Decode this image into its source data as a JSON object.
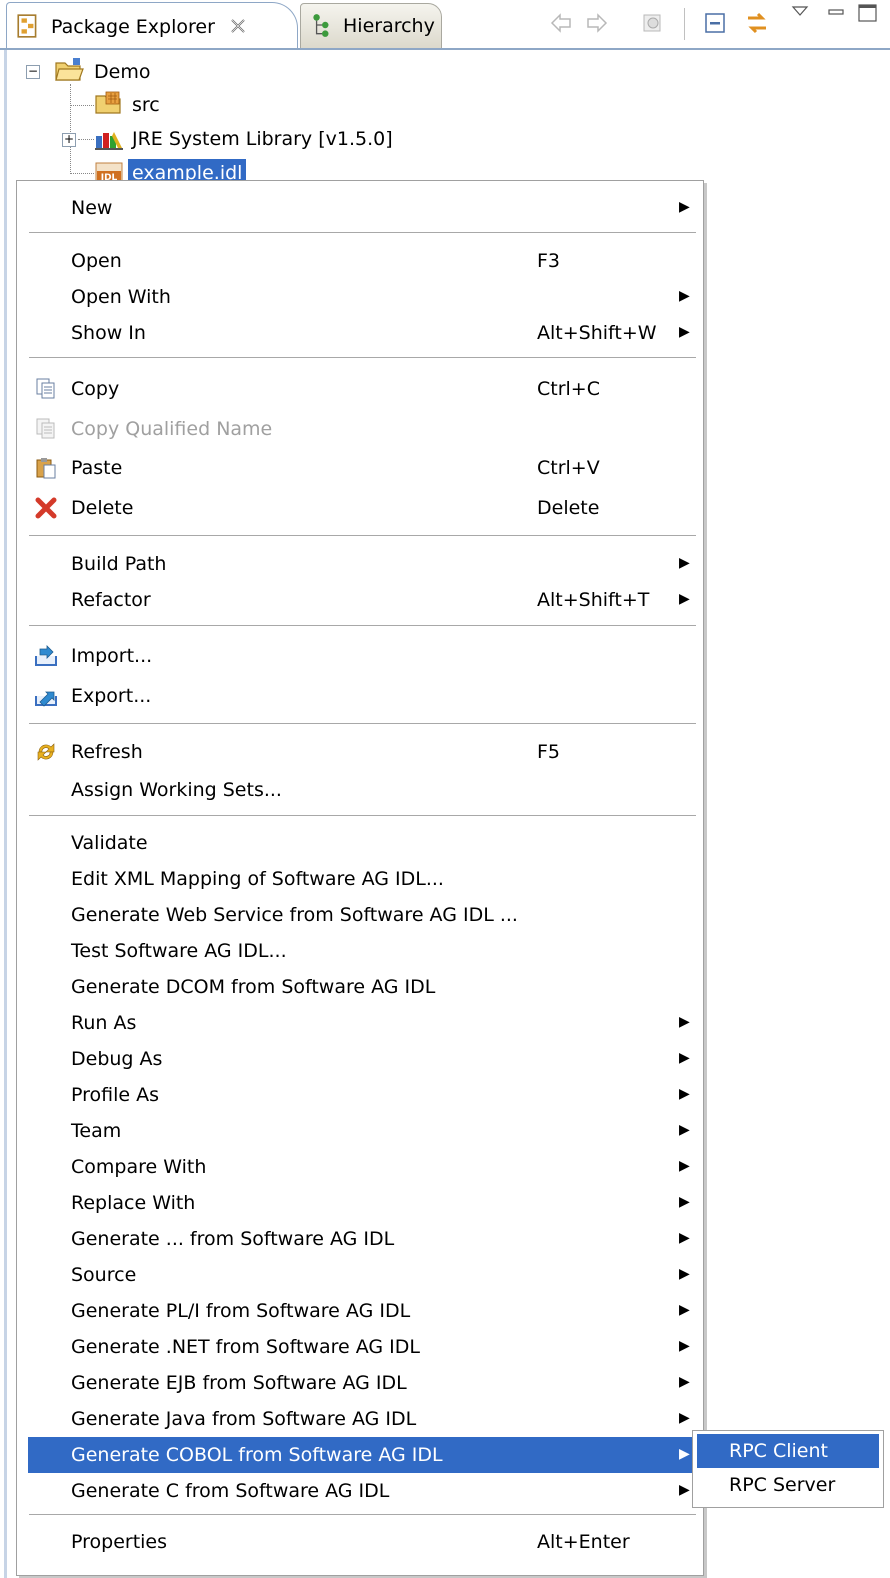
{
  "tabs": {
    "package_explorer": "Package Explorer",
    "hierarchy": "Hierarchy"
  },
  "tree": {
    "project": "Demo",
    "src": "src",
    "jre": "JRE System Library [v1.5.0]",
    "file": "example.idl",
    "file_badge": "IDL"
  },
  "menu": {
    "items": [
      {
        "label": "New",
        "shortcut": "",
        "submenu": true
      },
      {
        "label": "Open",
        "shortcut": "F3",
        "submenu": false
      },
      {
        "label": "Open With",
        "shortcut": "",
        "submenu": true
      },
      {
        "label": "Show In",
        "shortcut": "Alt+Shift+W",
        "submenu": true
      },
      {
        "label": "Copy",
        "shortcut": "Ctrl+C",
        "submenu": false
      },
      {
        "label": "Copy Qualified Name",
        "shortcut": "",
        "submenu": false
      },
      {
        "label": "Paste",
        "shortcut": "Ctrl+V",
        "submenu": false
      },
      {
        "label": "Delete",
        "shortcut": "Delete",
        "submenu": false
      },
      {
        "label": "Build Path",
        "shortcut": "",
        "submenu": true
      },
      {
        "label": "Refactor",
        "shortcut": "Alt+Shift+T",
        "submenu": true
      },
      {
        "label": "Import...",
        "shortcut": "",
        "submenu": false
      },
      {
        "label": "Export...",
        "shortcut": "",
        "submenu": false
      },
      {
        "label": "Refresh",
        "shortcut": "F5",
        "submenu": false
      },
      {
        "label": "Assign Working Sets...",
        "shortcut": "",
        "submenu": false
      },
      {
        "label": "Validate",
        "shortcut": "",
        "submenu": false
      },
      {
        "label": "Edit XML Mapping of Software AG IDL...",
        "shortcut": "",
        "submenu": false
      },
      {
        "label": "Generate Web Service from Software AG IDL ...",
        "shortcut": "",
        "submenu": false
      },
      {
        "label": "Test Software AG IDL...",
        "shortcut": "",
        "submenu": false
      },
      {
        "label": "Generate DCOM from Software AG IDL",
        "shortcut": "",
        "submenu": false
      },
      {
        "label": "Run As",
        "shortcut": "",
        "submenu": true
      },
      {
        "label": "Debug As",
        "shortcut": "",
        "submenu": true
      },
      {
        "label": "Profile As",
        "shortcut": "",
        "submenu": true
      },
      {
        "label": "Team",
        "shortcut": "",
        "submenu": true
      },
      {
        "label": "Compare With",
        "shortcut": "",
        "submenu": true
      },
      {
        "label": "Replace With",
        "shortcut": "",
        "submenu": true
      },
      {
        "label": "Generate ... from Software AG IDL",
        "shortcut": "",
        "submenu": true
      },
      {
        "label": "Source",
        "shortcut": "",
        "submenu": true
      },
      {
        "label": "Generate PL/I from Software AG IDL",
        "shortcut": "",
        "submenu": true
      },
      {
        "label": "Generate .NET from Software AG IDL",
        "shortcut": "",
        "submenu": true
      },
      {
        "label": "Generate EJB from Software AG IDL",
        "shortcut": "",
        "submenu": true
      },
      {
        "label": "Generate Java from Software AG IDL",
        "shortcut": "",
        "submenu": true
      },
      {
        "label": "Generate COBOL from Software AG IDL",
        "shortcut": "",
        "submenu": true
      },
      {
        "label": "Generate C from Software AG IDL",
        "shortcut": "",
        "submenu": true
      },
      {
        "label": "Properties",
        "shortcut": "Alt+Enter",
        "submenu": false
      }
    ],
    "submenu_arrow": "▶",
    "highlighted": "Generate COBOL from Software AG IDL"
  },
  "submenu": {
    "items": [
      "RPC Client",
      "RPC Server"
    ],
    "highlighted": "RPC Client"
  },
  "colors": {
    "selection": "#316ac5",
    "tab_border": "#8ea7c6",
    "delete_red": "#d43a2a"
  }
}
